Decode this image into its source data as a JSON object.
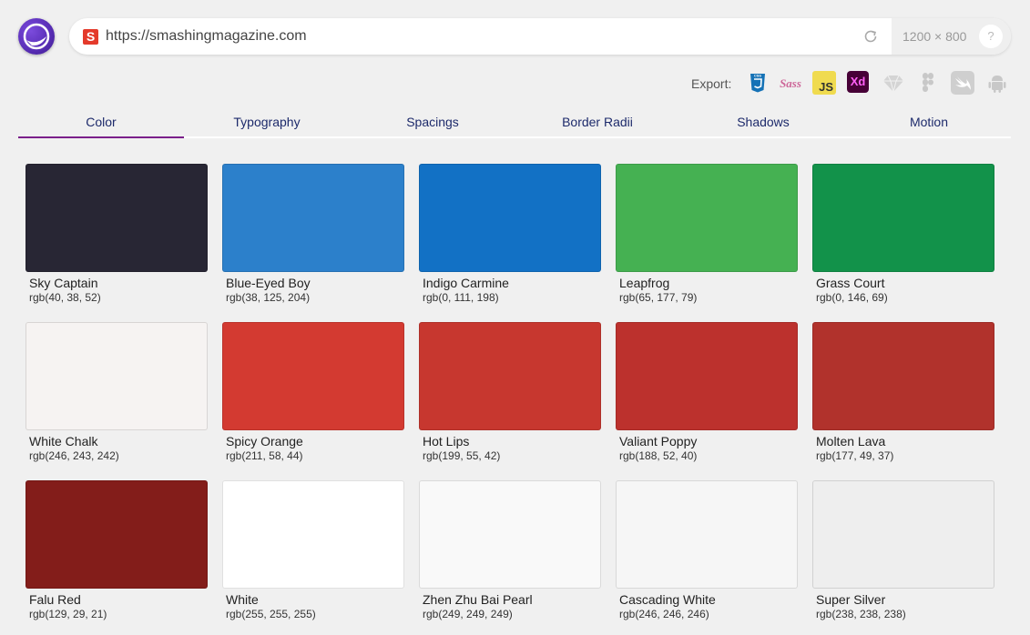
{
  "url": {
    "value": "https://smashingmagazine.com",
    "favicon_letter": "S"
  },
  "viewport": {
    "size_text": "1200 × 800",
    "help_label": "?"
  },
  "export": {
    "label": "Export:",
    "icons": [
      "css3-icon",
      "sass-icon",
      "js-icon",
      "adobe-xd-icon",
      "sketch-icon",
      "figma-icon",
      "swift-icon",
      "android-icon"
    ],
    "js_text": "JS",
    "xd_text": "Xd",
    "sass_text": "Sass"
  },
  "tabs": [
    "Color",
    "Typography",
    "Spacings",
    "Border Radii",
    "Shadows",
    "Motion"
  ],
  "active_tab": "Color",
  "colors": [
    {
      "name": "Sky Captain",
      "rgb": "rgb(40, 38, 52)",
      "hex": "#282634"
    },
    {
      "name": "Blue-Eyed Boy",
      "rgb": "rgb(38, 125, 204)",
      "hex": "#2c80cb"
    },
    {
      "name": "Indigo Carmine",
      "rgb": "rgb(0, 111, 198)",
      "hex": "#1271c5"
    },
    {
      "name": "Leapfrog",
      "rgb": "rgb(65, 177, 79)",
      "hex": "#45b152"
    },
    {
      "name": "Grass Court",
      "rgb": "rgb(0, 146, 69)",
      "hex": "#12924a"
    },
    {
      "name": "White Chalk",
      "rgb": "rgb(246, 243, 242)",
      "hex": "#f6f3f2"
    },
    {
      "name": "Spicy Orange",
      "rgb": "rgb(211, 58, 44)",
      "hex": "#d33a31"
    },
    {
      "name": "Hot Lips",
      "rgb": "rgb(199, 55, 42)",
      "hex": "#c7372f"
    },
    {
      "name": "Valiant Poppy",
      "rgb": "rgb(188, 52, 40)",
      "hex": "#bc312d"
    },
    {
      "name": "Molten Lava",
      "rgb": "rgb(177, 49, 37)",
      "hex": "#b1322c"
    },
    {
      "name": "Falu Red",
      "rgb": "rgb(129, 29, 21)",
      "hex": "#831d1a"
    },
    {
      "name": "White",
      "rgb": "rgb(255, 255, 255)",
      "hex": "#ffffff"
    },
    {
      "name": "Zhen Zhu Bai Pearl",
      "rgb": "rgb(249, 249, 249)",
      "hex": "#f9f9f9"
    },
    {
      "name": "Cascading White",
      "rgb": "rgb(246, 246, 246)",
      "hex": "#f6f6f6"
    },
    {
      "name": "Super Silver",
      "rgb": "rgb(238, 238, 238)",
      "hex": "#eeeeee"
    }
  ]
}
